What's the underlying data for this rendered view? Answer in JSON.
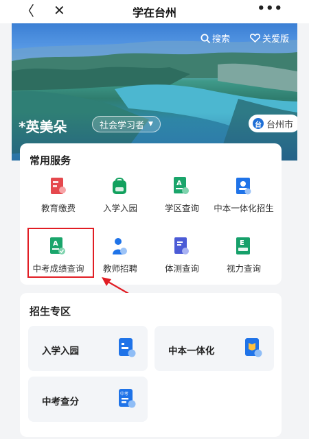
{
  "navbar": {
    "back_glyph": "〈",
    "close_glyph": "✕",
    "title": "学在台州",
    "more_glyph": "•••"
  },
  "hero": {
    "search_label": "搜索",
    "care_label": "关爱版",
    "user_name": "*英美朵",
    "role": "社会学习者",
    "city": "台州市",
    "city_badge": "台"
  },
  "common_services": {
    "title": "常用服务",
    "items": [
      {
        "label": "教育缴费",
        "icon": "payment-icon",
        "color": "#e5484d"
      },
      {
        "label": "入学入园",
        "icon": "schoolbag-icon",
        "color": "#12a15e"
      },
      {
        "label": "学区查询",
        "icon": "district-search-icon",
        "color": "#1aa56b"
      },
      {
        "label": "中本一体化招生",
        "icon": "id-card-icon",
        "color": "#1f73e8"
      },
      {
        "label": "中考成绩查询",
        "icon": "exam-score-icon",
        "color": "#1aa56b"
      },
      {
        "label": "教师招聘",
        "icon": "teacher-icon",
        "color": "#1f73e8"
      },
      {
        "label": "体测查询",
        "icon": "fitness-test-icon",
        "color": "#4b5bd6"
      },
      {
        "label": "视力查询",
        "icon": "eye-chart-icon",
        "color": "#16a06a"
      }
    ]
  },
  "enrollment_zone": {
    "title": "招生专区",
    "tiles": [
      {
        "label": "入学入园",
        "icon": "enroll-doc-icon"
      },
      {
        "label": "中本一体化",
        "icon": "book-search-icon"
      },
      {
        "label": "中考查分",
        "icon": "zhongkao-score-icon",
        "badge": "中考"
      }
    ]
  },
  "colors": {
    "annotation_red": "#e11d24",
    "icon_blue": "#1f73e8",
    "icon_green": "#1aa56b",
    "icon_red": "#e5484d"
  }
}
